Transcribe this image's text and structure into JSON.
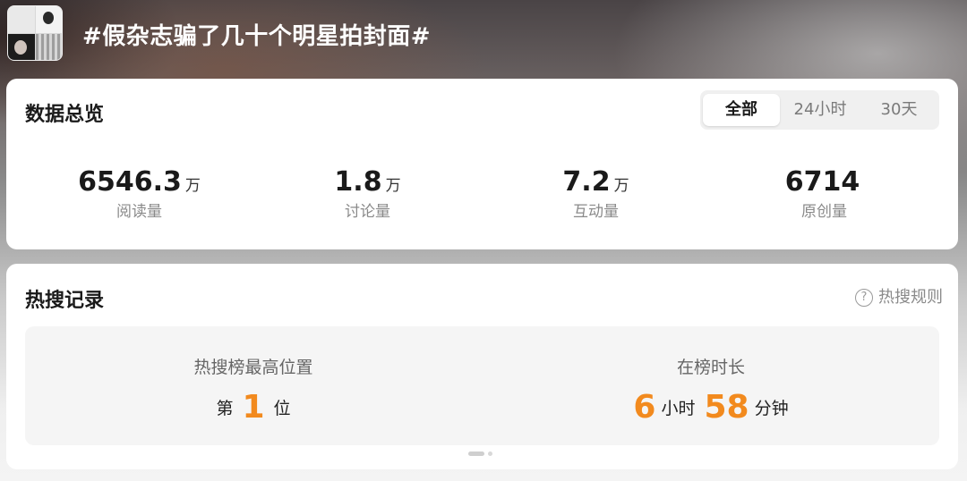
{
  "header": {
    "title": "#假杂志骗了几十个明星拍封面#"
  },
  "overview": {
    "title": "数据总览",
    "tabs": [
      {
        "label": "全部",
        "active": true
      },
      {
        "label": "24小时",
        "active": false
      },
      {
        "label": "30天",
        "active": false
      }
    ],
    "stats": [
      {
        "value": "6546.3",
        "unit": "万",
        "label": "阅读量"
      },
      {
        "value": "1.8",
        "unit": "万",
        "label": "讨论量"
      },
      {
        "value": "7.2",
        "unit": "万",
        "label": "互动量"
      },
      {
        "value": "6714",
        "unit": "",
        "label": "原创量"
      }
    ]
  },
  "hot_search": {
    "title": "热搜记录",
    "rules_icon": "question-circle-icon",
    "rules_label": "热搜规则",
    "peak": {
      "heading": "热搜榜最高位置",
      "prefix": "第",
      "value": "1",
      "suffix": "位"
    },
    "duration": {
      "heading": "在榜时长",
      "hours": "6",
      "hours_unit": "小时",
      "minutes": "58",
      "minutes_unit": "分钟"
    }
  },
  "colors": {
    "accent": "#f28a1e",
    "card": "#ffffff",
    "panel": "#f5f5f5"
  }
}
